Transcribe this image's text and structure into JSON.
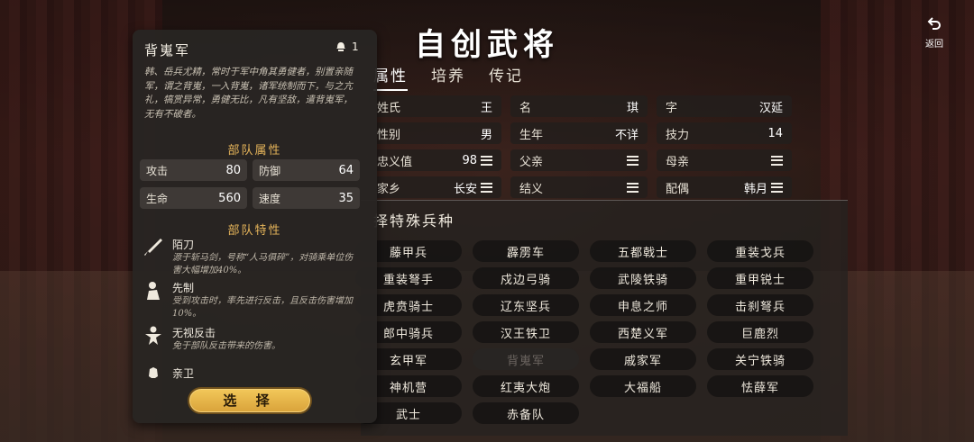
{
  "header": {
    "title": "自创武将",
    "back_label": "返回"
  },
  "tabs": [
    {
      "label": "属性",
      "active": true
    },
    {
      "label": "培养",
      "active": false
    },
    {
      "label": "传记",
      "active": false
    }
  ],
  "attributes": [
    {
      "key": "姓氏",
      "value": "王",
      "menu": false
    },
    {
      "key": "名",
      "value": "琪",
      "menu": false
    },
    {
      "key": "字",
      "value": "汉延",
      "menu": false
    },
    {
      "key": "性别",
      "value": "男",
      "menu": false
    },
    {
      "key": "生年",
      "value": "不详",
      "menu": false
    },
    {
      "key": "技力",
      "value": "14",
      "menu": false
    },
    {
      "key": "忠义值",
      "value": "98",
      "menu": true
    },
    {
      "key": "父亲",
      "value": "",
      "menu": true
    },
    {
      "key": "母亲",
      "value": "",
      "menu": true
    },
    {
      "key": "家乡",
      "value": "长安",
      "menu": true
    },
    {
      "key": "结义",
      "value": "",
      "menu": true
    },
    {
      "key": "配偶",
      "value": "韩月",
      "menu": true
    }
  ],
  "troop_section": {
    "title": "择特殊兵种",
    "items": [
      {
        "label": "藤甲兵",
        "disabled": false
      },
      {
        "label": "霹雳车",
        "disabled": false
      },
      {
        "label": "五都戟士",
        "disabled": false
      },
      {
        "label": "重装戈兵",
        "disabled": false
      },
      {
        "label": "重装弩手",
        "disabled": false
      },
      {
        "label": "戍边弓骑",
        "disabled": false
      },
      {
        "label": "武陵铁骑",
        "disabled": false
      },
      {
        "label": "重甲锐士",
        "disabled": false
      },
      {
        "label": "虎贲骑士",
        "disabled": false
      },
      {
        "label": "辽东坚兵",
        "disabled": false
      },
      {
        "label": "申息之师",
        "disabled": false
      },
      {
        "label": "击刹弩兵",
        "disabled": false
      },
      {
        "label": "郎中骑兵",
        "disabled": false
      },
      {
        "label": "汉王铁卫",
        "disabled": false
      },
      {
        "label": "西楚义军",
        "disabled": false
      },
      {
        "label": "巨鹿烈",
        "disabled": false
      },
      {
        "label": "玄甲军",
        "disabled": false
      },
      {
        "label": "背嵬军",
        "disabled": true
      },
      {
        "label": "戚家军",
        "disabled": false
      },
      {
        "label": "关宁铁骑",
        "disabled": false
      },
      {
        "label": "神机营",
        "disabled": false
      },
      {
        "label": "红夷大炮",
        "disabled": false
      },
      {
        "label": "大福船",
        "disabled": false
      },
      {
        "label": "怯薛军",
        "disabled": false
      },
      {
        "label": "武士",
        "disabled": false
      },
      {
        "label": "赤备队",
        "disabled": false
      }
    ]
  },
  "card": {
    "name": "背嵬军",
    "count": "1",
    "description": "韩、岳兵尤精，常时于军中角其勇健者，别置亲随军，谓之背嵬，一入背嵬，诸军统制而下，与之亢礼，犒赏异常，勇健无比，凡有坚敌，遣背嵬军，无有不破者。",
    "attr_title": "部队属性",
    "stats": [
      {
        "key": "攻击",
        "value": "80"
      },
      {
        "key": "防御",
        "value": "64"
      },
      {
        "key": "生命",
        "value": "560"
      },
      {
        "key": "速度",
        "value": "35"
      }
    ],
    "trait_title": "部队特性",
    "traits": [
      {
        "name": "陌刀",
        "desc": "源于斩马剑，号称“人马俱碎”，对骑乘单位伤害大幅增加40%。"
      },
      {
        "name": "先制",
        "desc": "受到攻击时，率先进行反击，且反击伤害增加10%。"
      },
      {
        "name": "无视反击",
        "desc": "免于部队反击带来的伤害。"
      },
      {
        "name": "亲卫",
        "desc": ""
      }
    ],
    "select_label": "选 择"
  },
  "colors": {
    "accent_gold": "#e5b45a",
    "button_gold": "#f3c85a",
    "panel_dark": "#28252"
  }
}
